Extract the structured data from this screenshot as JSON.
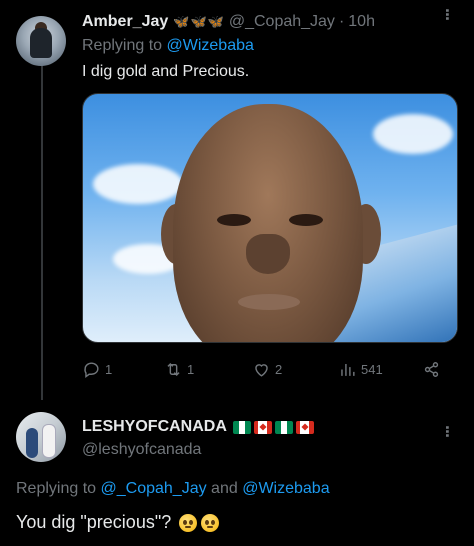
{
  "tweet1": {
    "display_name": "Amber_Jay",
    "badge_emojis": "🦋🦋🦋",
    "handle": "@_Copah_Jay",
    "separator": "·",
    "time": "10h",
    "replying_prefix": "Replying to",
    "replying_to": "@Wizebaba",
    "text": "I dig gold and Precious.",
    "media": {
      "description_icon": "photo"
    },
    "actions": {
      "replies": "1",
      "retweets": "1",
      "likes": "2",
      "views": "541"
    }
  },
  "tweet2": {
    "display_name": "LESHYOFCANADA",
    "flags": [
      "ng",
      "ca",
      "ng",
      "ca"
    ],
    "handle": "@leshyofcanada",
    "replying_prefix": "Replying to",
    "replying_to_1": "@_Copah_Jay",
    "replying_and": "and",
    "replying_to_2": "@Wizebaba",
    "text": "You dig \"precious\"?",
    "emojis": [
      "pleading-face",
      "pleading-face"
    ]
  },
  "colors": {
    "background": "#000000",
    "primary_text": "#e7e9ea",
    "secondary_text": "#71767b",
    "link": "#1d9bf0",
    "divider": "#2f3336"
  }
}
